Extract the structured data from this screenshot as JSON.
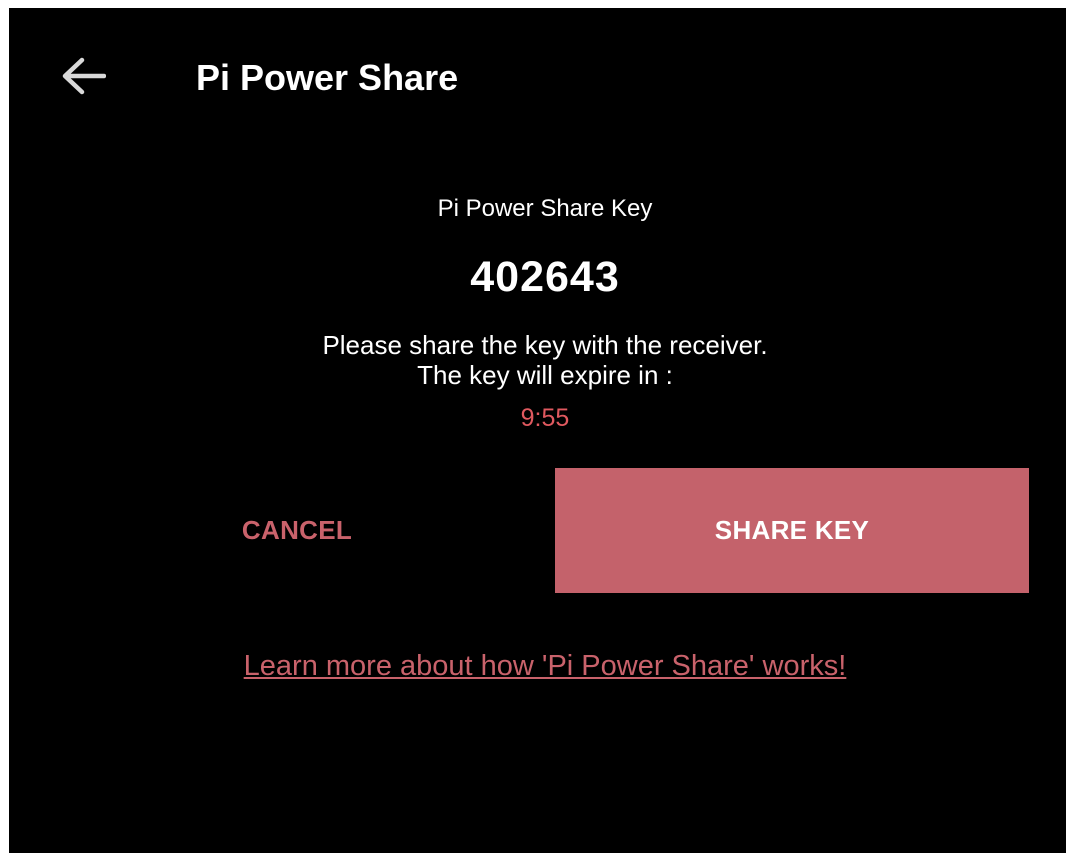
{
  "header": {
    "back_icon": "arrow-left-icon",
    "title": "Pi Power Share"
  },
  "key_panel": {
    "label": "Pi Power Share Key",
    "key": "402643",
    "instruction_line1": "Please share the key with the receiver.",
    "instruction_line2": "The key will expire in :",
    "countdown": "9:55"
  },
  "actions": {
    "cancel_label": "CANCEL",
    "share_label": "SHARE KEY"
  },
  "footer": {
    "learn_more": "Learn more about how 'Pi Power Share' works!"
  },
  "colors": {
    "background": "#000000",
    "accent": "#c4626b",
    "countdown": "#e0595f",
    "text": "#ffffff"
  }
}
